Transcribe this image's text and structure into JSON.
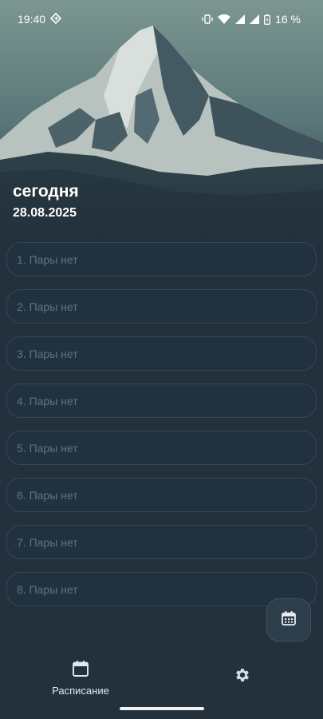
{
  "status_bar": {
    "time": "19:40",
    "battery": "16 %"
  },
  "header": {
    "day": "сегодня",
    "date": "28.08.2025"
  },
  "lessons": [
    {
      "label": "1. Пары нет"
    },
    {
      "label": "2. Пары нет"
    },
    {
      "label": "3. Пары нет"
    },
    {
      "label": "4. Пары нет"
    },
    {
      "label": "5. Пары нет"
    },
    {
      "label": "6. Пары нет"
    },
    {
      "label": "7. Пары нет"
    },
    {
      "label": "8. Пары нет"
    }
  ],
  "fab": {
    "icon": "calendar-icon"
  },
  "nav": {
    "schedule_label": "Расписание",
    "schedule_icon": "calendar-icon",
    "settings_icon": "gear-icon"
  },
  "colors": {
    "background": "#23313c",
    "card_border": "#33475a",
    "card_text": "#5d7385"
  }
}
